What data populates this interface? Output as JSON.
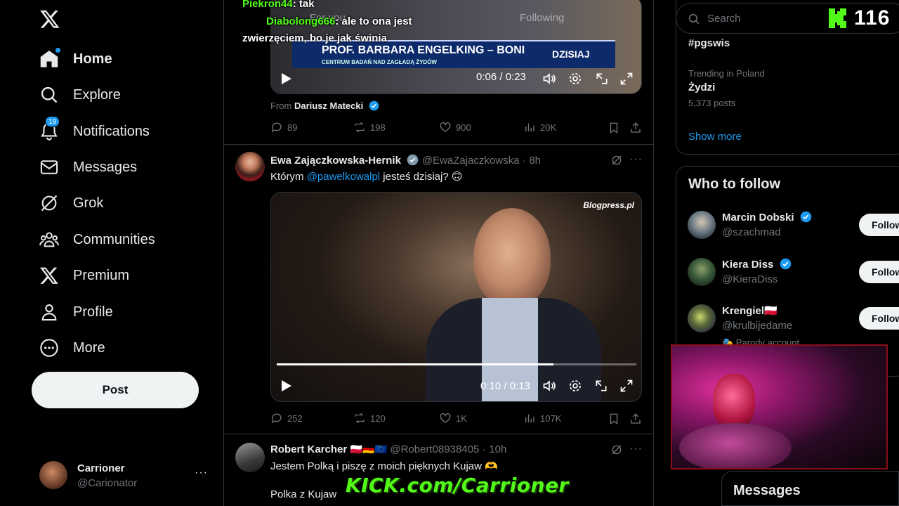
{
  "nav": {
    "items": [
      {
        "label": "Home",
        "icon": "home-icon"
      },
      {
        "label": "Explore",
        "icon": "search-icon"
      },
      {
        "label": "Notifications",
        "icon": "bell-icon",
        "badge": "19"
      },
      {
        "label": "Messages",
        "icon": "envelope-icon"
      },
      {
        "label": "Grok",
        "icon": "grok-icon"
      },
      {
        "label": "Communities",
        "icon": "people-icon"
      },
      {
        "label": "Premium",
        "icon": "x-icon"
      },
      {
        "label": "Profile",
        "icon": "person-icon"
      },
      {
        "label": "More",
        "icon": "more-circle-icon"
      }
    ],
    "post_label": "Post"
  },
  "account": {
    "name": "Carrioner",
    "handle": "@Carionator",
    "more": "···"
  },
  "tabs": {
    "for_you": "For you",
    "following": "Following"
  },
  "chat_overlay": [
    {
      "user": "Piekron44",
      "text": ": tak"
    },
    {
      "user": "Diabolong666",
      "text": ": ale to ona jest"
    },
    {
      "user": "",
      "text": "zwierzęciem, bo je jak świnia"
    }
  ],
  "tweet1": {
    "video_banner_title": "PROF. BARBARA ENGELKING – BONI",
    "video_banner_sub": "CENTRUM BADAŃ NAD ZAGŁADĄ ŻYDÓW",
    "video_channel": "DZISIAJ",
    "video_time": "0:06 / 0:23",
    "from_label": "From",
    "from_name": "Dariusz Matecki",
    "replies": "89",
    "reposts": "198",
    "likes": "900",
    "views": "20K"
  },
  "tweet2": {
    "name": "Ewa Zajączkowska-Hernik",
    "handle": "@EwaZajaczkowska",
    "sep": "·",
    "time": "8h",
    "text_pre": "Którym ",
    "mention": "@pawelkowalpl",
    "text_post": " jesteś dzisiaj? 🙃",
    "watermark": "Blogpress.pl",
    "video_time": "0:10 / 0:13",
    "video_progress": 0.77,
    "replies": "252",
    "reposts": "120",
    "likes": "1K",
    "views": "107K"
  },
  "tweet3": {
    "name": "Robert Karcher",
    "flags": "🇵🇱🇩🇪🇪🇺",
    "handle": "@Robert08938405",
    "sep": "·",
    "time": "10h",
    "line1": "Jestem Polką i piszę z moich pięknych Kujaw 🫶",
    "line2": "Polka z Kujaw"
  },
  "search": {
    "placeholder": "Search"
  },
  "kick": {
    "viewers": "116",
    "banner": "KICK.com/Carrioner"
  },
  "trends": {
    "top_tag": "#pgswis",
    "context": "Trending in Poland",
    "topic": "Żydzi",
    "posts": "5,373 posts",
    "show_more": "Show more"
  },
  "who_to_follow": {
    "title": "Who to follow",
    "follow_label": "Follow",
    "people": [
      {
        "name": "Marcin Dobski",
        "handle": "@szachmad",
        "verified": true
      },
      {
        "name": "Kiera Diss",
        "handle": "@KieraDiss",
        "verified": true
      },
      {
        "name": "Krengiel🇵🇱",
        "handle": "@krulbijedame",
        "verified": false,
        "note": "🎭 Parody account"
      }
    ]
  },
  "messages_drawer": {
    "label": "Messages"
  },
  "colors": {
    "accent": "#1d9bf0",
    "kick_green": "#53fc18",
    "border": "#2f3336",
    "muted": "#71767b"
  }
}
